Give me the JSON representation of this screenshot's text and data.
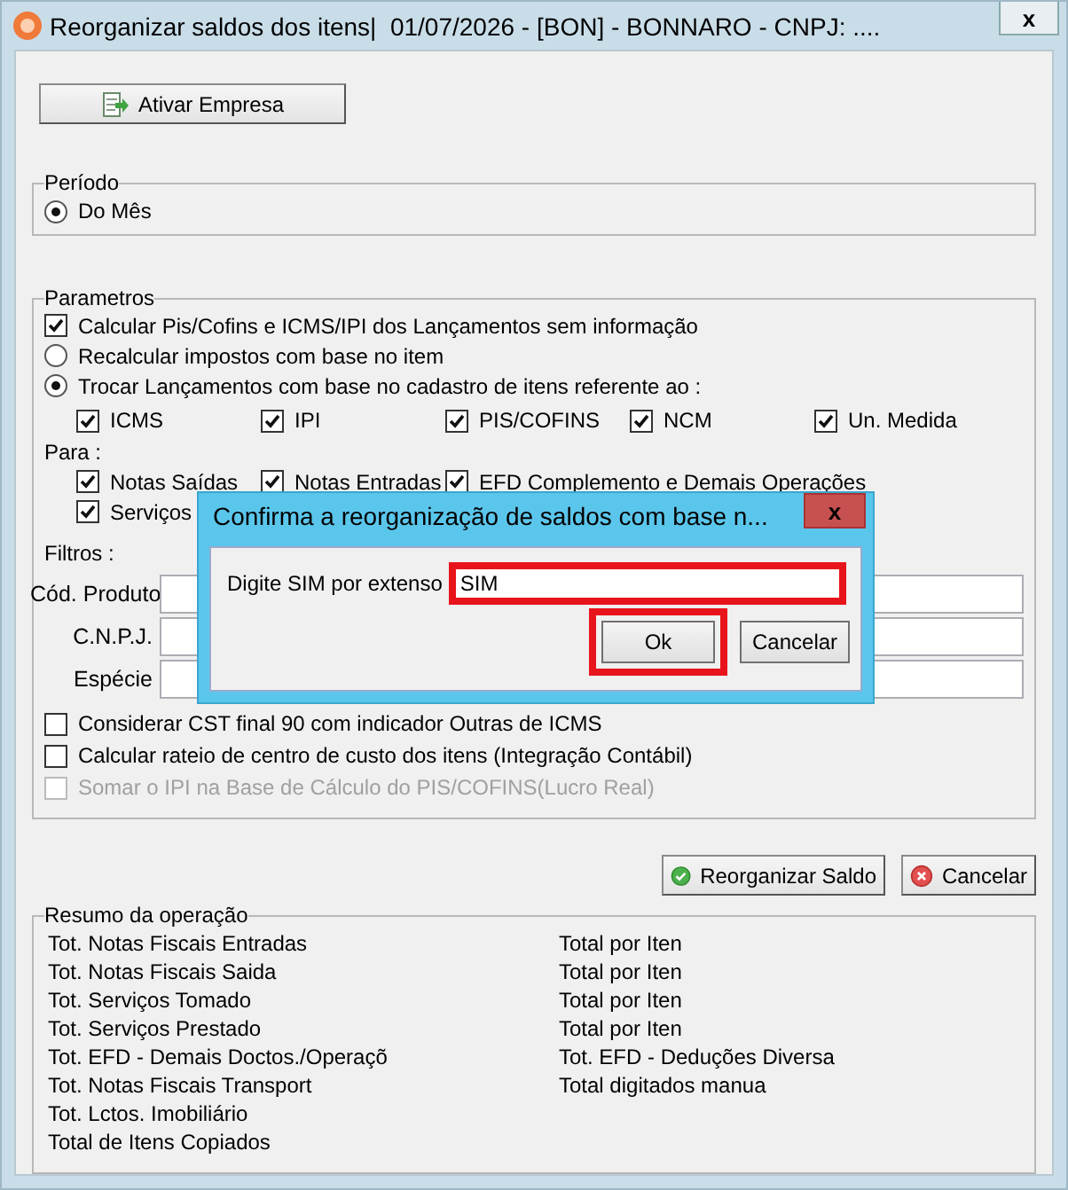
{
  "window": {
    "title": "Reorganizar saldos dos itens|  01/07/2026 - [BON] - BONNARO - CNPJ: ....",
    "close": "x"
  },
  "activate_button": "Ativar Empresa",
  "period": {
    "title": "Período",
    "options": [
      {
        "label": "Do Mês",
        "selected": true
      }
    ]
  },
  "parameters": {
    "title": "Parametros",
    "options": [
      {
        "kind": "checkbox",
        "label": "Calcular Pis/Cofins e ICMS/IPI dos Lançamentos sem informação",
        "checked": true
      },
      {
        "kind": "radio",
        "label": "Recalcular impostos com base no item",
        "selected": false
      },
      {
        "kind": "radio",
        "label": "Trocar Lançamentos com base no cadastro de itens referente ao :",
        "selected": true
      }
    ],
    "taxes": [
      {
        "label": "ICMS",
        "checked": true
      },
      {
        "label": "IPI",
        "checked": true
      },
      {
        "label": "PIS/COFINS",
        "checked": true
      },
      {
        "label": "NCM",
        "checked": true
      },
      {
        "label": "Un. Medida",
        "checked": true
      }
    ],
    "targets_label": "Para :",
    "targets": [
      {
        "label": "Notas Saídas",
        "checked": true
      },
      {
        "label": "Notas Entradas",
        "checked": true
      },
      {
        "label": "EFD Complemento e Demais Operações",
        "checked": true
      },
      {
        "label": "Serviços",
        "checked": true
      }
    ],
    "filters_label": "Filtros :",
    "filters": [
      {
        "label": "Cód. Produto"
      },
      {
        "label": "C.N.P.J."
      },
      {
        "label": "Espécie"
      }
    ],
    "extra_options": [
      {
        "label": "Considerar CST final 90 com indicador Outras de ICMS",
        "checked": false,
        "disabled": false
      },
      {
        "label": "Calcular rateio de centro de custo dos itens   (Integração Contábil)",
        "checked": false,
        "disabled": false
      },
      {
        "label": "Somar o IPI na Base de Cálculo do PIS/COFINS(Lucro Real)",
        "checked": false,
        "disabled": true
      }
    ]
  },
  "actions": [
    {
      "kind": "confirm",
      "label": "Reorganizar Saldo"
    },
    {
      "kind": "cancel",
      "label": "Cancelar"
    }
  ],
  "summary": {
    "title": "Resumo da operação",
    "left": [
      "Tot. Notas Fiscais Entradas",
      "Tot. Notas Fiscais Saida",
      "Tot. Serviços Tomado",
      "Tot. Serviços Prestado",
      "Tot. EFD - Demais Doctos./Operaçõ",
      "Tot. Notas Fiscais Transport",
      "Tot. Lctos. Imobiliário",
      "Total de Itens Copiados"
    ],
    "right": [
      "Total por Iten",
      "Total por Iten",
      "Total por Iten",
      "Total por Iten",
      "Tot. EFD - Deduções Diversa",
      "Total digitados manua"
    ]
  },
  "dialog": {
    "title": "Confirma a reorganização de saldos com base n...",
    "close": "x",
    "field_label": "Digite SIM por extenso",
    "value": "SIM",
    "field_highlighted": true,
    "buttons": [
      {
        "label": "Ok",
        "highlighted": true
      },
      {
        "label": "Cancelar",
        "highlighted": false
      }
    ]
  }
}
